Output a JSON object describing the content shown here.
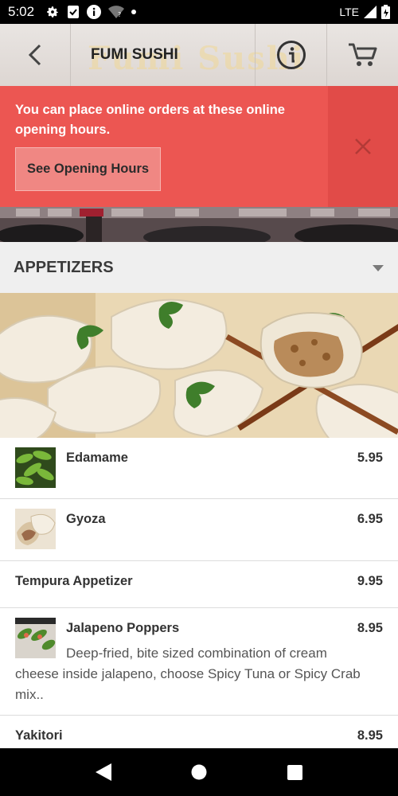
{
  "status_bar": {
    "time": "5:02",
    "network": "LTE",
    "icons": [
      "gear-icon",
      "clipboard-check-icon",
      "info-icon",
      "wifi-question-icon",
      "dot-icon",
      "signal-icon",
      "battery-icon"
    ]
  },
  "appbar": {
    "title": "FUMI SUSHI",
    "watermark": "Fumi Sushi"
  },
  "banner": {
    "message": "You can place online orders at these online opening hours.",
    "button_label": "See Opening Hours",
    "colors": {
      "background": "#ec5652",
      "close_background": "#e14b48"
    }
  },
  "section": {
    "title": "APPETIZERS"
  },
  "menu": {
    "items": [
      {
        "name": "Edamame",
        "price": "5.95",
        "thumb": "edamame"
      },
      {
        "name": "Gyoza",
        "price": "6.95",
        "thumb": "gyoza"
      },
      {
        "name": "Tempura Appetizer",
        "price": "9.95"
      },
      {
        "name": "Jalapeno Poppers",
        "price": "8.95",
        "thumb": "poppers",
        "description": "Deep-fried, bite sized combination of cream cheese inside jalapeno, choose Spicy Tuna or Spicy Crab mix.."
      },
      {
        "name": "Yakitori",
        "price": "8.95"
      }
    ]
  }
}
